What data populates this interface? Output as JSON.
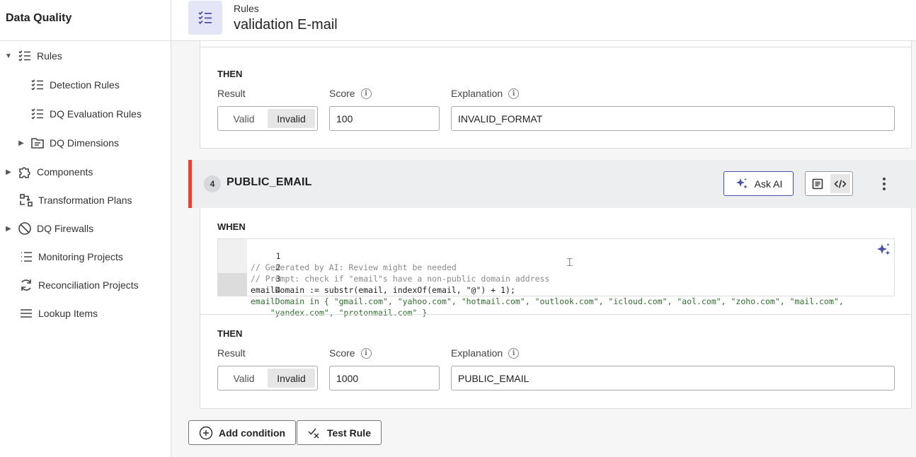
{
  "app": {
    "title": "Data Quality"
  },
  "sidebar": {
    "items": [
      {
        "label": "Rules",
        "icon": "checklist-icon",
        "caret": "expanded"
      },
      {
        "label": "Detection Rules",
        "icon": "checklist-icon"
      },
      {
        "label": "DQ Evaluation Rules",
        "icon": "checklist-icon"
      },
      {
        "label": "DQ Dimensions",
        "icon": "folder-icon",
        "caret": "collapsed"
      },
      {
        "label": "Components",
        "icon": "puzzle-icon",
        "caret": "collapsed"
      },
      {
        "label": "Transformation Plans",
        "icon": "transform-icon"
      },
      {
        "label": "DQ Firewalls",
        "icon": "prohibit-icon",
        "caret": "collapsed"
      },
      {
        "label": "Monitoring Projects",
        "icon": "list-icon"
      },
      {
        "label": "Reconciliation Projects",
        "icon": "refresh-icon"
      },
      {
        "label": "Lookup Items",
        "icon": "menu-icon"
      }
    ]
  },
  "header": {
    "breadcrumb": "Rules",
    "title": "validation E-mail",
    "icon": "checklist-icon"
  },
  "card1": {
    "then_label": "THEN",
    "result_label": "Result",
    "result_options": [
      "Valid",
      "Invalid"
    ],
    "result_selected": "Invalid",
    "score_label": "Score",
    "score_value": "100",
    "explanation_label": "Explanation",
    "explanation_value": "INVALID_FORMAT"
  },
  "rule4": {
    "number": "4",
    "name": "PUBLIC_EMAIL",
    "ask_ai_label": "Ask AI",
    "when_label": "WHEN",
    "code_lines": [
      {
        "n": "1",
        "text": "// Generated by AI: Review might be needed"
      },
      {
        "n": "2",
        "text": "// Prompt: check if \"email\"s have a non-public domain address"
      },
      {
        "n": "3",
        "text": "emailDomain := substr(email, indexOf(email, \"@\") + 1);"
      },
      {
        "n": "4",
        "text": "emailDomain in { \"gmail.com\", \"yahoo.com\", \"hotmail.com\", \"outlook.com\", \"icloud.com\", \"aol.com\", \"zoho.com\", \"mail.com\","
      },
      {
        "n": "",
        "text": "    \"yandex.com\", \"protonmail.com\" }"
      }
    ],
    "then_label": "THEN",
    "result_label": "Result",
    "result_options": [
      "Valid",
      "Invalid"
    ],
    "result_selected": "Invalid",
    "score_label": "Score",
    "score_value": "1000",
    "explanation_label": "Explanation",
    "explanation_value": "PUBLIC_EMAIL"
  },
  "footer": {
    "add_condition_label": "Add condition",
    "test_rule_label": "Test Rule"
  },
  "colors": {
    "accent": "#4a4fa8",
    "rule_marker": "#e0453a"
  }
}
